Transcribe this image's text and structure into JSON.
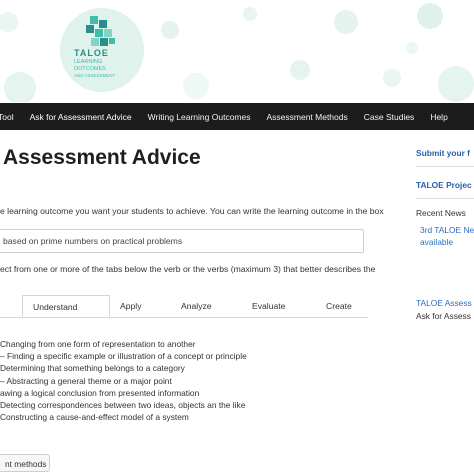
{
  "logo": {
    "name": "TALOE",
    "tagline_lines": [
      "LEARNING",
      "OUTCOMES",
      "AND ASSESSMENT"
    ],
    "colors": {
      "teal": "#3fbfa7",
      "dark": "#2a8f8a",
      "bubble": "#d9efe8"
    }
  },
  "nav": {
    "items": [
      {
        "label": "Tool"
      },
      {
        "label": "Ask for Assessment Advice"
      },
      {
        "label": "Writing Learning Outcomes"
      },
      {
        "label": "Assessment Methods"
      },
      {
        "label": "Case Studies"
      },
      {
        "label": "Help"
      }
    ]
  },
  "main": {
    "title": "Assessment Advice",
    "instruction_1": "e learning outcome you want your students to achieve. You can write the learning outcome in the box",
    "input_value": "based on prime numbers on practical problems",
    "instruction_2": "ect from one or more of the tabs below the verb or the verbs (maximum 3) that better describes the",
    "tabs": [
      {
        "label": ""
      },
      {
        "label": "Understand"
      },
      {
        "label": "Apply"
      },
      {
        "label": "Analyze"
      },
      {
        "label": "Evaluate"
      },
      {
        "label": "Create"
      }
    ],
    "verbs": [
      "Changing from one form of representation to another",
      "– Finding a specific example or illustration of a concept or principle",
      "Determining that something belongs to a category",
      "– Abstracting a general theme or a major point",
      "awing a logical conclusion from presented information",
      "Detecting correspondences between two ideas, objects an the like",
      "Constructing a cause-and-effect model of a system"
    ],
    "bottom_button": "nt methods"
  },
  "sidebar": {
    "submit": "Submit your f",
    "project": "TALOE Projec",
    "recent_news": "Recent News",
    "news_link": "3rd TALOE Ne",
    "news_link_2": "available",
    "assess_1": "TALOE Assess",
    "assess_2": "Ask for Assess"
  }
}
